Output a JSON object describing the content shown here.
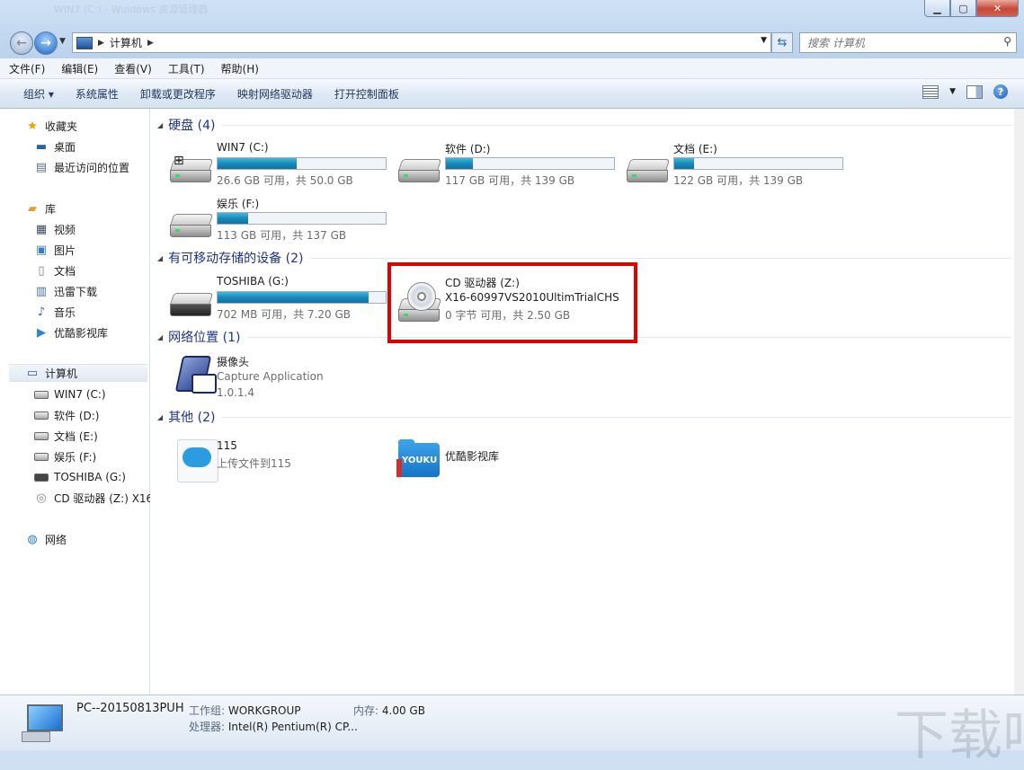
{
  "window": {
    "title_ghost": "WIN7 (C:) - Windows 资源管理器"
  },
  "address": {
    "root": "计算机"
  },
  "search": {
    "placeholder": "搜索 计算机"
  },
  "menu": [
    "文件(F)",
    "编辑(E)",
    "查看(V)",
    "工具(T)",
    "帮助(H)"
  ],
  "commands": [
    "组织 ▾",
    "系统属性",
    "卸载或更改程序",
    "映射网络驱动器",
    "打开控制面板"
  ],
  "sidebar": {
    "favorites": {
      "label": "收藏夹",
      "items": [
        "桌面",
        "最近访问的位置"
      ]
    },
    "libraries": {
      "label": "库",
      "items": [
        "视频",
        "图片",
        "文档",
        "迅雷下载",
        "音乐",
        "优酷影视库"
      ]
    },
    "computer": {
      "label": "计算机",
      "items": [
        "WIN7 (C:)",
        "软件 (D:)",
        "文档 (E:)",
        "娱乐 (F:)",
        "TOSHIBA (G:)",
        "CD 驱动器 (Z:) X16"
      ]
    },
    "network": {
      "label": "网络"
    }
  },
  "groups": {
    "hdd": "硬盘 (4)",
    "removable": "有可移动存储的设备 (2)",
    "network": "网络位置 (1)",
    "other": "其他 (2)"
  },
  "drives": [
    {
      "name": "WIN7 (C:)",
      "free": "26.6 GB 可用，共 50.0 GB",
      "used_fraction": 0.47
    },
    {
      "name": "软件 (D:)",
      "free": "117 GB 可用，共 139 GB",
      "used_fraction": 0.16
    },
    {
      "name": "文档 (E:)",
      "free": "122 GB 可用，共 139 GB",
      "used_fraction": 0.12
    },
    {
      "name": "娱乐 (F:)",
      "free": "113 GB 可用，共 137 GB",
      "used_fraction": 0.18
    }
  ],
  "removable": [
    {
      "name": "TOSHIBA (G:)",
      "free": "702 MB 可用，共 7.20 GB",
      "used_fraction": 0.9
    },
    {
      "name": "CD 驱动器 (Z:)",
      "label": "X16-60997VS2010UltimTrialCHS",
      "free": "0 字节 可用，共 2.50 GB"
    }
  ],
  "netloc": {
    "name": "摄像头",
    "line2": "Capture Application",
    "line3": "1.0.1.4"
  },
  "other": [
    {
      "name": "115",
      "line2": "上传文件到115"
    },
    {
      "name": "优酷影视库"
    }
  ],
  "details": {
    "pcname": "PC--20150813PUH",
    "workgroup_k": "工作组:",
    "workgroup_v": "WORKGROUP",
    "memory_k": "内存:",
    "memory_v": "4.00 GB",
    "cpu_k": "处理器:",
    "cpu_v": "Intel(R) Pentium(R) CP..."
  },
  "watermark": "下载吧",
  "icons": {
    "youku_text": "YOUKU"
  },
  "colors": {
    "highlight": "#e00000",
    "bar_fill": "#1a8ab9",
    "group_title": "#1e3287"
  }
}
